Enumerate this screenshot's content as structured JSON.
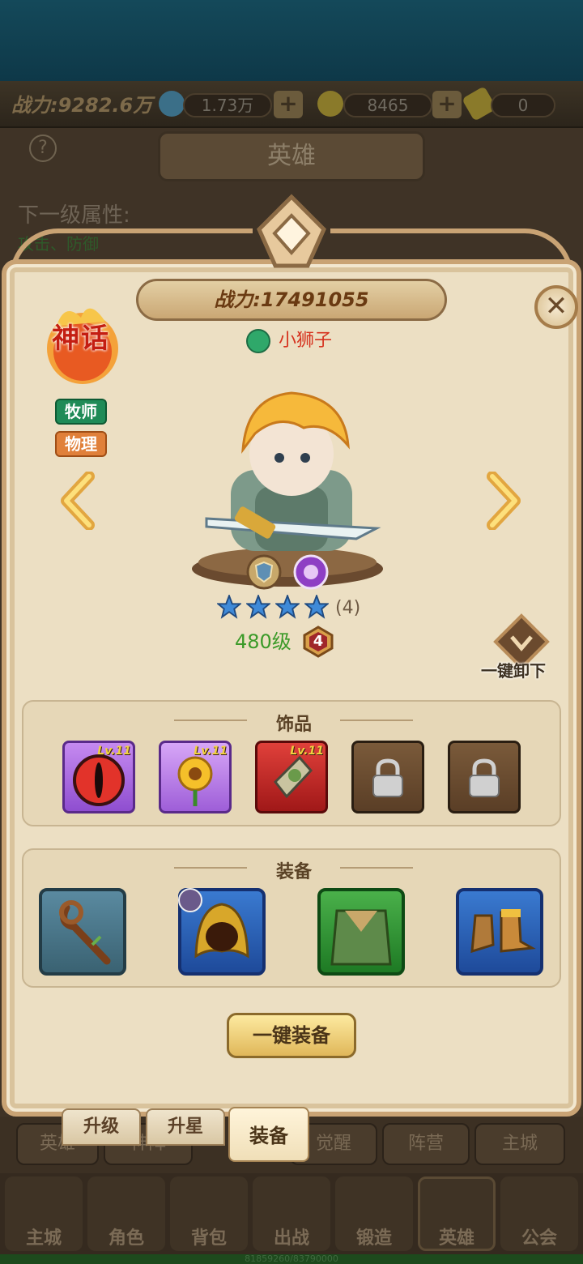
{
  "resources": {
    "power_label": "战力:9282.6万",
    "gems": "1.73万",
    "gold": "8465",
    "tickets": "0"
  },
  "background": {
    "title": "英雄",
    "next_level_label": "下一级属性:",
    "next_level_sub": "攻击、防御"
  },
  "hero": {
    "power": "战力:17491055",
    "owner_name": "小狮子",
    "rarity_badge": "神话",
    "class_tag": "牧师",
    "damage_type_tag": "物理",
    "stars": 4,
    "star_count_text": "(4)",
    "level_text": "480级",
    "tier": "4"
  },
  "actions": {
    "unequip_all_label": "一键卸下",
    "equip_all_label": "一键装备"
  },
  "accessories": {
    "title": "饰品",
    "slots": [
      {
        "name": "red-eye-accessory",
        "level": "Lv.11",
        "locked": false
      },
      {
        "name": "sunflower-accessory",
        "level": "Lv.11",
        "locked": false
      },
      {
        "name": "emblem-accessory",
        "level": "Lv.11",
        "locked": false
      },
      {
        "name": "locked-slot",
        "level": "",
        "locked": true
      },
      {
        "name": "locked-slot",
        "level": "",
        "locked": true
      }
    ]
  },
  "equipment": {
    "title": "装备",
    "slots": [
      {
        "name": "wooden-staff"
      },
      {
        "name": "golden-hood"
      },
      {
        "name": "green-robe"
      },
      {
        "name": "golden-boots"
      }
    ]
  },
  "sub_tabs": [
    "升级",
    "升星",
    "装备"
  ],
  "dim_tabs": [
    "英雄",
    "神阵",
    "觉醒",
    "阵营",
    "主城"
  ],
  "nav": [
    "主城",
    "角色",
    "背包",
    "出战",
    "锻造",
    "英雄",
    "公会"
  ],
  "xp_text": "81859260/83790000",
  "colors": {
    "panel_bg": "#ecdfc3",
    "panel_border": "#c9a374",
    "level_green": "#3a9a28",
    "owner_red": "#d6321e"
  }
}
